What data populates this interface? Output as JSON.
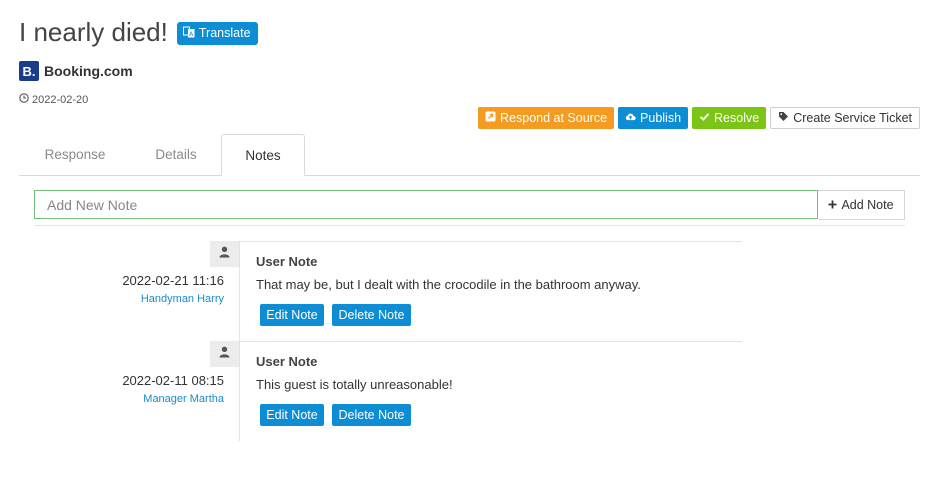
{
  "review": {
    "title": "I nearly died!",
    "translate_label": "Translate",
    "source_logo_letter": "B.",
    "source_name": "Booking.com",
    "date": "2022-02-20"
  },
  "actions": {
    "respond_label": "Respond at Source",
    "publish_label": "Publish",
    "resolve_label": "Resolve",
    "ticket_label": "Create Service Ticket"
  },
  "tabs": [
    {
      "label": "Response",
      "active": false
    },
    {
      "label": "Details",
      "active": false
    },
    {
      "label": "Notes",
      "active": true
    }
  ],
  "new_note": {
    "placeholder": "Add New Note",
    "value": "",
    "add_label": "Add Note"
  },
  "notes": [
    {
      "datetime": "2022-02-21 11:16",
      "author": "Handyman Harry",
      "heading": "User Note",
      "body": "That may be, but I dealt with the crocodile in the bathroom anyway.",
      "edit_label": "Edit Note",
      "delete_label": "Delete Note"
    },
    {
      "datetime": "2022-02-11 08:15",
      "author": "Manager Martha",
      "heading": "User Note",
      "body": "This guest is totally unreasonable!",
      "edit_label": "Edit Note",
      "delete_label": "Delete Note"
    }
  ],
  "colors": {
    "primary": "#0d8dd3",
    "respond": "#f39c1f",
    "resolve": "#7cc416",
    "input_border": "#74c27a",
    "link": "#1a8bcf"
  },
  "icons": {
    "translate": "translate-icon",
    "clock": "clock-icon",
    "respond": "external-link-icon",
    "publish": "cloud-upload-icon",
    "resolve": "check-icon",
    "ticket": "tag-icon",
    "add": "plus-icon",
    "avatar": "user-icon"
  }
}
